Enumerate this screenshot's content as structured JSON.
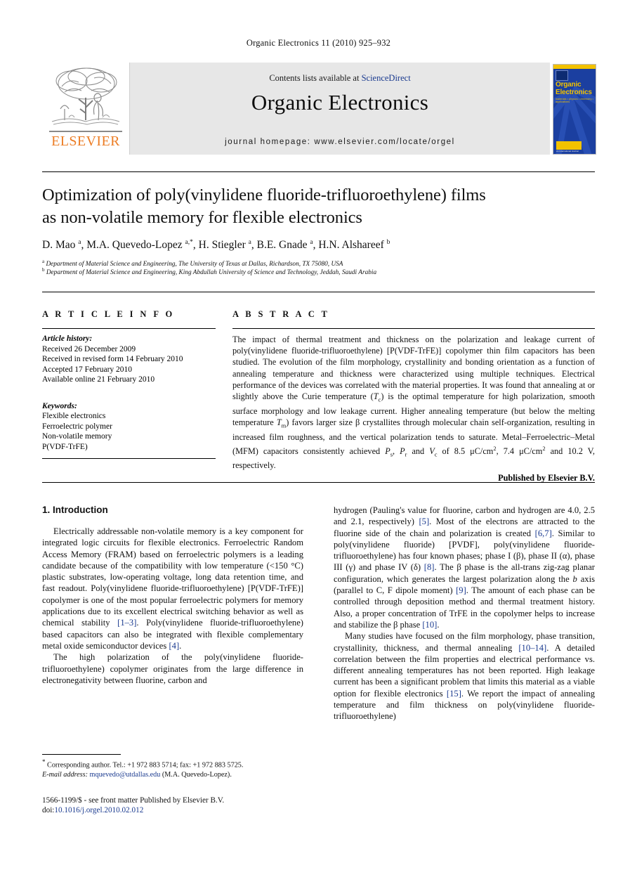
{
  "running_head": "Organic Electronics 11 (2010) 925–932",
  "masthead": {
    "contents_prefix": "Contents lists available at ",
    "sciencedirect": "ScienceDirect",
    "journal_title": "Organic Electronics",
    "homepage": "journal homepage: www.elsevier.com/locate/orgel",
    "publisher_logo_word": "ELSEVIER",
    "cover": {
      "title_line1": "Organic",
      "title_line2": "Electronics",
      "subtitle": "materials • physics • chemistry • applications",
      "footer_text": "An International Journal"
    },
    "accent_blue": "#1a3a8f",
    "band_gray": "#e7e7e7",
    "elsevier_orange": "#ec7d25",
    "cover_blue": "#1b3fa0",
    "cover_yellow": "#f2c200"
  },
  "article": {
    "title_line1": "Optimization of poly(vinylidene fluoride-trifluoroethylene) films",
    "title_line2": "as non-volatile memory for flexible electronics",
    "authors": "D. Mao a, M.A. Quevedo-Lopez a,*, H. Stiegler a, B.E. Gnade a, H.N. Alshareef b",
    "affiliation_a": "Department of Material Science and Engineering, The University of Texas at Dallas, Richardson, TX 75080, USA",
    "affiliation_b": "Department of Material Science and Engineering, King Abdullah University of Science and Technology, Jeddah, Saudi Arabia"
  },
  "article_info": {
    "heading": "A R T I C L E   I N F O",
    "history_label": "Article history:",
    "history": [
      "Received 26 December 2009",
      "Received in revised form 14 February 2010",
      "Accepted 17 February 2010",
      "Available online 21 February 2010"
    ],
    "keywords_label": "Keywords:",
    "keywords": [
      "Flexible electronics",
      "Ferroelectric polymer",
      "Non-volatile memory",
      "P(VDF-TrFE)"
    ]
  },
  "abstract": {
    "heading": "A B S T R A C T",
    "publisher_line": "Published by Elsevier B.V."
  },
  "introduction": {
    "heading": "1. Introduction"
  },
  "footnote": {
    "corresponding": "Corresponding author. Tel.: +1 972 883 5714; fax: +1 972 883 5725.",
    "email_label": "E-mail address:",
    "email": "mquevedo@utdallas.edu",
    "email_owner": "(M.A. Quevedo-Lopez)."
  },
  "imprint": {
    "issn_line": "1566-1199/$ - see front matter Published by Elsevier B.V.",
    "doi_label": "doi:",
    "doi": "10.1016/j.orgel.2010.02.012"
  }
}
